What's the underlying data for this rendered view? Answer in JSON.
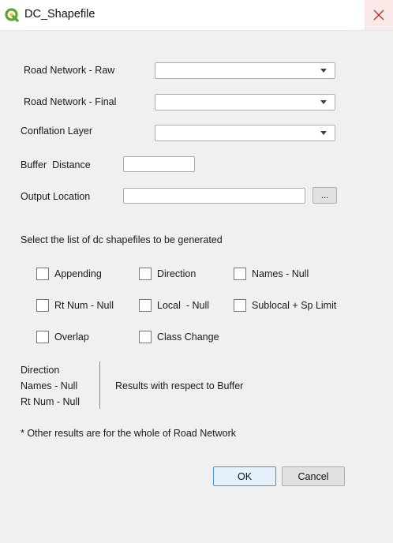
{
  "window": {
    "title": "DC_Shapefile",
    "close_icon": "close-icon",
    "app_icon": "qgis-logo-icon",
    "accent": "#5aa832"
  },
  "form": {
    "road_network_raw_label": "Road Network - Raw",
    "road_network_final_label": "Road Network - Final",
    "conflation_layer_label": "Conflation Layer",
    "buffer_distance_label": "Buffer  Distance",
    "buffer_distance_value": "",
    "output_location_label": "Output Location",
    "output_location_value": "",
    "browse_label": "...",
    "road_network_raw_value": "",
    "road_network_final_value": "",
    "conflation_layer_value": ""
  },
  "shapefiles": {
    "heading": "Select the list of dc shapefiles to be generated",
    "options": [
      {
        "label": "Appending",
        "checked": false
      },
      {
        "label": "Direction",
        "checked": false
      },
      {
        "label": "Names - Null",
        "checked": false
      },
      {
        "label": "Rt Num - Null",
        "checked": false
      },
      {
        "label": "Local  - Null",
        "checked": false
      },
      {
        "label": "Sublocal + Sp Limit",
        "checked": false
      },
      {
        "label": "Overlap",
        "checked": false
      },
      {
        "label": "Class Change",
        "checked": false
      }
    ]
  },
  "notes": {
    "buffer_items": [
      "Direction",
      "Names - Null",
      "Rt Num - Null"
    ],
    "buffer_note": "Results with respect to Buffer",
    "footnote": "* Other results are for the whole of Road Network"
  },
  "buttons": {
    "ok": "OK",
    "cancel": "Cancel"
  }
}
